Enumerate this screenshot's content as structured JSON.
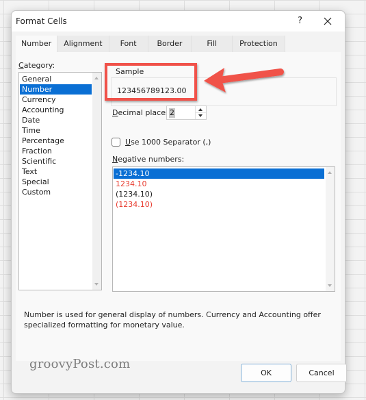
{
  "dialog": {
    "title": "Format Cells",
    "help_label": "?",
    "close_icon": "close-x-icon"
  },
  "tabs": [
    {
      "label": "Number",
      "active": true
    },
    {
      "label": "Alignment",
      "active": false
    },
    {
      "label": "Font",
      "active": false
    },
    {
      "label": "Border",
      "active": false
    },
    {
      "label": "Fill",
      "active": false
    },
    {
      "label": "Protection",
      "active": false
    }
  ],
  "category": {
    "label": "Category:",
    "accel": "C",
    "label_rest": "ategory:",
    "items": [
      "General",
      "Number",
      "Currency",
      "Accounting",
      "Date",
      "Time",
      "Percentage",
      "Fraction",
      "Scientific",
      "Text",
      "Special",
      "Custom"
    ],
    "selected": "Number"
  },
  "sample": {
    "label": "Sample",
    "value": "123456789123.00"
  },
  "decimal_places": {
    "accel": "D",
    "label_rest": "ecimal places:",
    "value": "2"
  },
  "separator": {
    "accel": "U",
    "label_rest": "se 1000 Separator (,)",
    "checked": false
  },
  "negative_numbers": {
    "accel": "N",
    "label_rest": "egative numbers:",
    "items": [
      {
        "text": "-1234.10",
        "color": "#ffffff",
        "selected": true
      },
      {
        "text": "1234.10",
        "color": "#e8392c",
        "selected": false
      },
      {
        "text": "(1234.10)",
        "color": "#1f1f1f",
        "selected": false
      },
      {
        "text": "(1234.10)",
        "color": "#e8392c",
        "selected": false
      }
    ]
  },
  "description": "Number is used for general display of numbers.  Currency and Accounting offer specialized formatting for monetary value.",
  "buttons": {
    "ok": "OK",
    "cancel": "Cancel"
  },
  "watermark": "groovyPost.com",
  "colors": {
    "accent": "#0a6fd4",
    "annotation": "#f0524a",
    "negative_red": "#e8392c"
  }
}
